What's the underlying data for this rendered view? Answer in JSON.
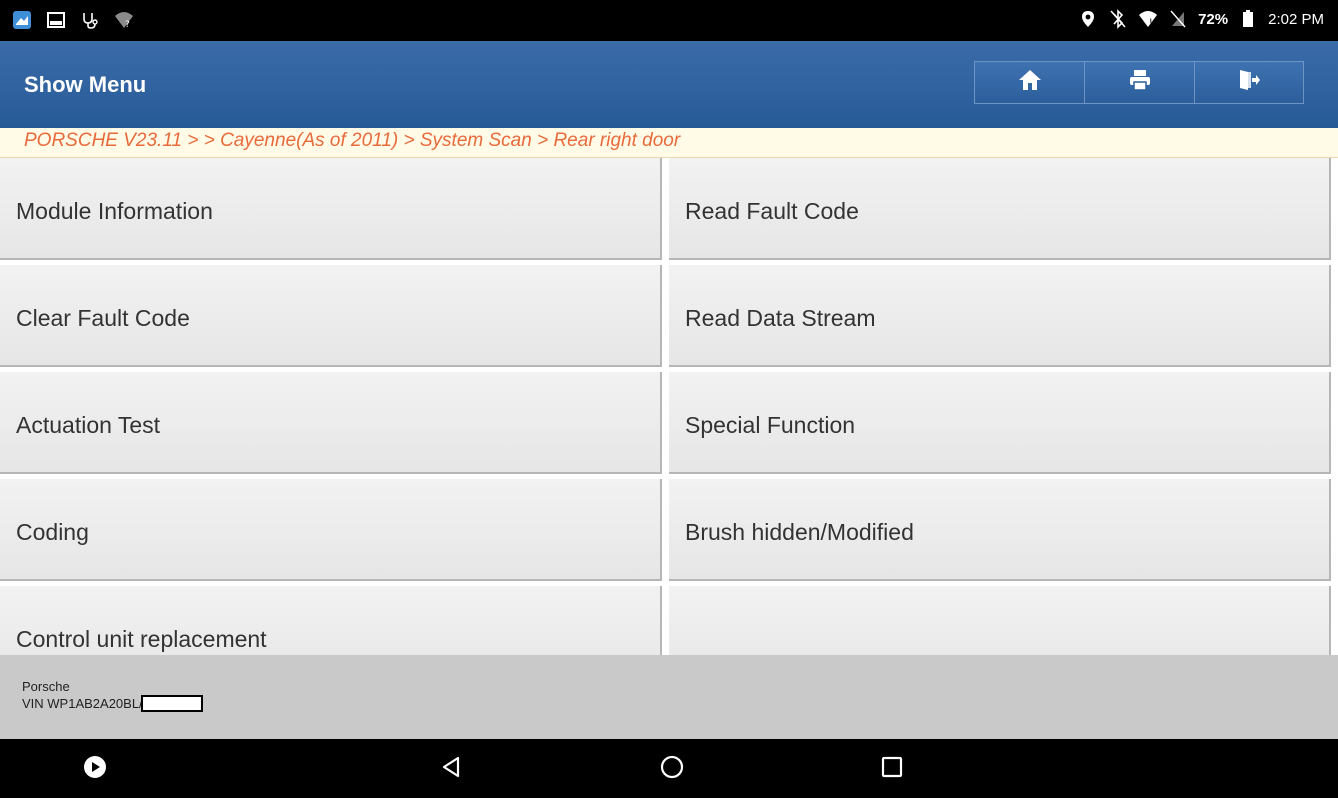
{
  "status_bar": {
    "left_icons": [
      "app-icon",
      "image-icon",
      "stethoscope-icon",
      "wifi-question-icon"
    ],
    "right_icons": [
      "location-icon",
      "bluetooth-off-icon",
      "wifi-icon",
      "no-sim-icon"
    ],
    "battery": "72%",
    "time": "2:02 PM"
  },
  "app_bar": {
    "title": "Show Menu",
    "buttons": [
      "home-icon",
      "print-icon",
      "exit-icon"
    ]
  },
  "breadcrumb": "PORSCHE V23.11 >  > Cayenne(As of 2011) > System Scan > Rear right door",
  "menu": [
    "Module Information",
    "Read Fault Code",
    "Clear Fault Code",
    "Read Data Stream",
    "Actuation Test",
    "Special Function",
    "Coding",
    "Brush hidden/Modified",
    "Control unit replacement",
    ""
  ],
  "footer": {
    "make": "Porsche",
    "vin": "VIN WP1AB2A20BL/"
  },
  "nav_bar": [
    "play-icon",
    "back-icon",
    "home-circle-icon",
    "recents-icon"
  ],
  "colors": {
    "app_bar": "#2e62a0",
    "breadcrumb_text": "#e86a3b",
    "breadcrumb_bg": "#fffbe6",
    "footer_bg": "#c9c9c9"
  }
}
